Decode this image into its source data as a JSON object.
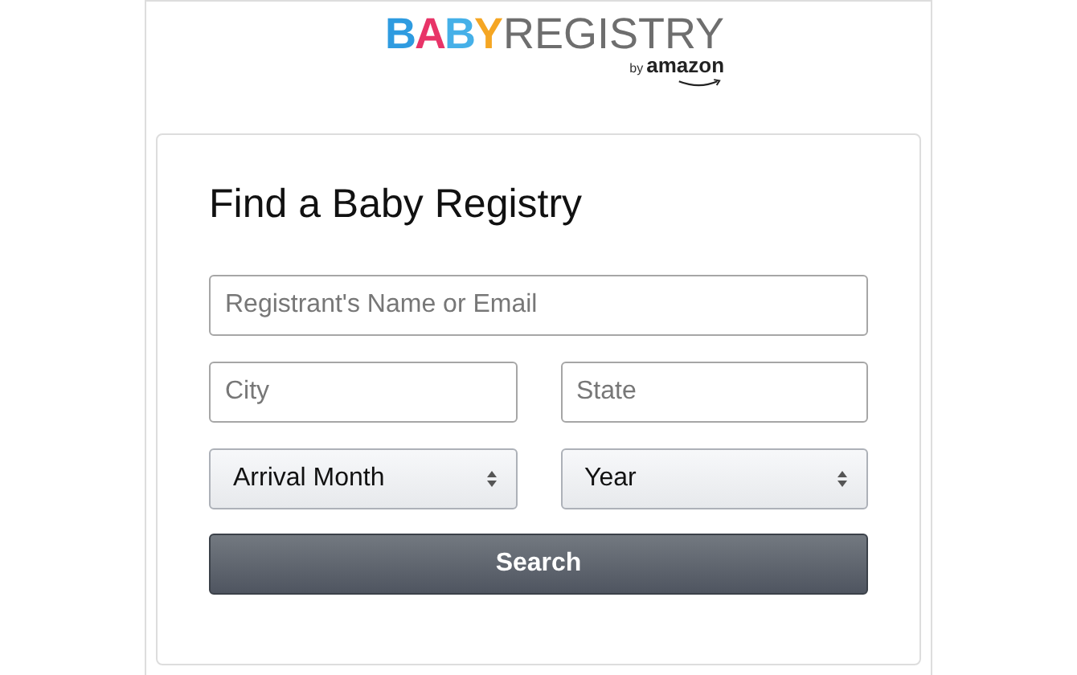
{
  "logo": {
    "letters": [
      {
        "text": "B",
        "color": "#2e9be0"
      },
      {
        "text": "A",
        "color": "#e83468"
      },
      {
        "text": "B",
        "color": "#45b0e8"
      },
      {
        "text": "Y",
        "color": "#f5a623"
      }
    ],
    "word": "REGISTRY",
    "by": "by",
    "brand": "amazon"
  },
  "form": {
    "title": "Find a Baby Registry",
    "fields": [
      {
        "kind": "text",
        "placeholder": "Registrant's Name or Email"
      },
      {
        "kind": "text",
        "placeholder": "City"
      },
      {
        "kind": "text",
        "placeholder": "State"
      },
      {
        "kind": "select",
        "value": "Arrival Month"
      },
      {
        "kind": "select",
        "value": "Year"
      }
    ],
    "button": "Search"
  }
}
